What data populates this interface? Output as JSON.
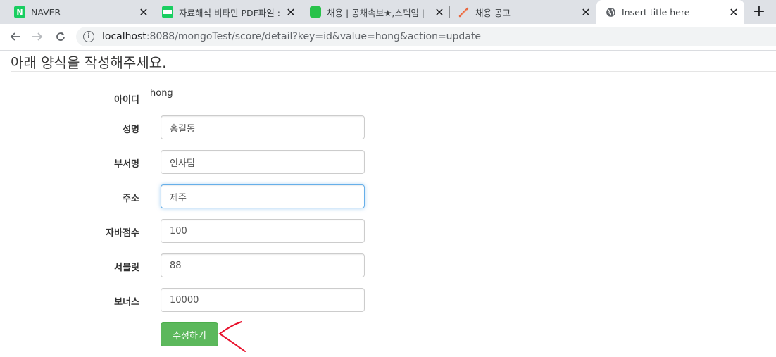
{
  "browser": {
    "tabs": [
      {
        "title": "NAVER",
        "favicon": "naver-icon",
        "active": false
      },
      {
        "title": "자료해석 비타민 PDF파일 :",
        "favicon": "blog-icon",
        "active": false
      },
      {
        "title": "채용 | 공채속보★,스펙업 |",
        "favicon": "spec-up-icon",
        "active": false
      },
      {
        "title": "채용 공고",
        "favicon": "feather-icon",
        "active": false
      },
      {
        "title": "Insert title here",
        "favicon": "globe-icon",
        "active": true
      }
    ],
    "new_tab": "+",
    "close_glyph": "✕",
    "url_host": "localhost",
    "url_rest": ":8088/mongoTest/score/detail?key=id&value=hong&action=update"
  },
  "page": {
    "heading": "아래 양식을 작성해주세요.",
    "id_label": "아이디",
    "id_value": "hong",
    "fields": [
      {
        "label": "성명",
        "value": "홍길동",
        "focused": false
      },
      {
        "label": "부서명",
        "value": "인사팀",
        "focused": false
      },
      {
        "label": "주소",
        "value": "제주",
        "focused": true
      },
      {
        "label": "자바점수",
        "value": "100",
        "focused": false
      },
      {
        "label": "서블릿",
        "value": "88",
        "focused": false
      },
      {
        "label": "보너스",
        "value": "10000",
        "focused": false
      }
    ],
    "submit_label": "수정하기"
  },
  "colors": {
    "button": "#5cb85c",
    "annotation": "#e8102b",
    "focus": "#66afe9"
  }
}
